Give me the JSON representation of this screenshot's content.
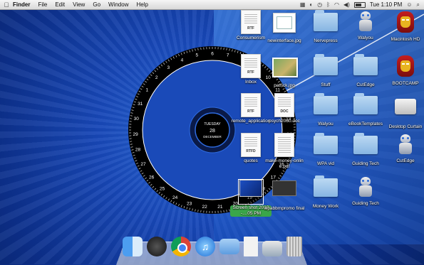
{
  "menubar": {
    "apple": "",
    "items": [
      "Finder",
      "File",
      "Edit",
      "View",
      "Go",
      "Window",
      "Help"
    ],
    "clock": "Tue 1:10 PM"
  },
  "clock_widget": {
    "day": "TUESDAY",
    "date": "28",
    "month": "DECEMBER",
    "outer_ring_numbers": [
      "6",
      "7",
      "8",
      "9",
      "10",
      "11",
      "12",
      "13",
      "14",
      "15",
      "16",
      "17",
      "18",
      "19",
      "20",
      "21",
      "22",
      "23",
      "24",
      "25",
      "26",
      "27",
      "28",
      "29",
      "30",
      "31",
      "1",
      "2",
      "3",
      "4",
      "5"
    ],
    "inner_ring_numbers": [
      "12",
      "1",
      "2",
      "3",
      "4",
      "5",
      "6",
      "7",
      "8",
      "9",
      "10",
      "11"
    ]
  },
  "desktop_icons": [
    {
      "label": "Consumerism",
      "type": "doc",
      "tag": "RTF"
    },
    {
      "label": "newinterface.jpg",
      "type": "image"
    },
    {
      "label": "Nervepress",
      "type": "folder"
    },
    {
      "label": "Walyou",
      "type": "robot"
    },
    {
      "label": "Macintosh HD",
      "type": "ironman"
    },
    {
      "label": "Inbox",
      "type": "doc",
      "tag": "RTF"
    },
    {
      "label": "patrick.jpg",
      "type": "photo"
    },
    {
      "label": "Stuff",
      "type": "folder"
    },
    {
      "label": "CutEdge",
      "type": "folder"
    },
    {
      "label": "BOOTCAMP",
      "type": "ironman"
    },
    {
      "label": "remote_application",
      "type": "doc",
      "tag": "RTF"
    },
    {
      "label": "psych2060.doc",
      "type": "doc",
      "tag": "DOC"
    },
    {
      "label": "Walyou",
      "type": "folder"
    },
    {
      "label": "eBookTemplates",
      "type": "folder"
    },
    {
      "label": "Desktop Curtain",
      "type": "drive"
    },
    {
      "label": "quotes",
      "type": "doc",
      "tag": "RTFD"
    },
    {
      "label": "make-money-online.pdf",
      "type": "pdf"
    },
    {
      "label": "WPA vid",
      "type": "folder"
    },
    {
      "label": "Guiding Tech",
      "type": "folder"
    },
    {
      "label": "CutEdge",
      "type": "robot"
    },
    {
      "label": "Screen shot 2010-....05 PM",
      "type": "screenshot",
      "selected": true
    },
    {
      "label": "wpabbmpromo final",
      "type": "video"
    },
    {
      "label": "Money Work",
      "type": "folder"
    },
    {
      "label": "Guiding Tech",
      "type": "robot"
    }
  ],
  "dock": [
    "finder-icon",
    "dashboard-icon",
    "chrome-icon",
    "itunes-icon",
    "applications-folder-icon",
    "documents-stack-icon",
    "preview-icon",
    "trash-icon"
  ],
  "colors": {
    "desktop_blue": "#1848b8",
    "selection_green": "#3aa64a",
    "clock_ring": "#000000"
  }
}
